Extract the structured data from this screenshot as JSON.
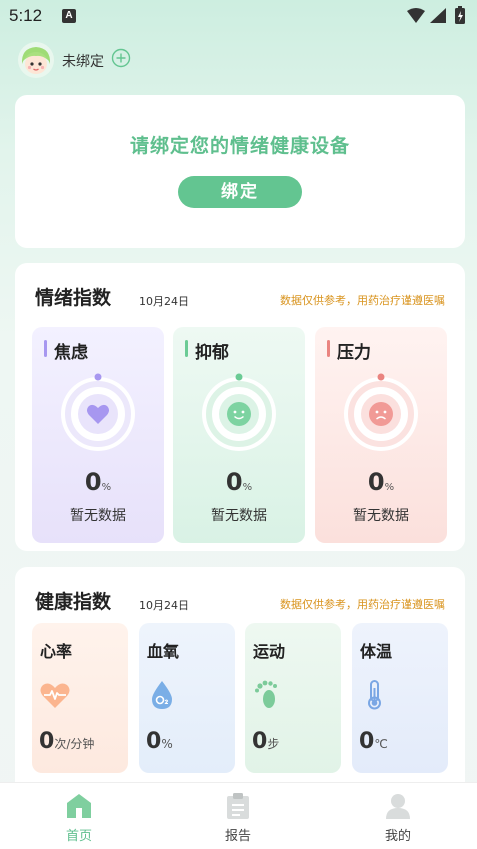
{
  "status_bar": {
    "time": "5:12",
    "notif_letter": "A"
  },
  "header": {
    "bind_status": "未绑定"
  },
  "bind_card": {
    "title": "请绑定您的情绪健康设备",
    "button": "绑定"
  },
  "emotion": {
    "title": "情绪指数",
    "date": "10月24日",
    "note": "数据仅供参考，用药治疗谨遵医嘱",
    "items": [
      {
        "name": "焦虑",
        "value": "0",
        "unit": "%",
        "status": "暂无数据",
        "color": "#a797f0",
        "icon": "heart-icon"
      },
      {
        "name": "抑郁",
        "value": "0",
        "unit": "%",
        "status": "暂无数据",
        "color": "#6bcb95",
        "icon": "smile-icon"
      },
      {
        "name": "压力",
        "value": "0",
        "unit": "%",
        "status": "暂无数据",
        "color": "#ea8480",
        "icon": "frown-icon"
      }
    ]
  },
  "health": {
    "title": "健康指数",
    "date": "10月24日",
    "note": "数据仅供参考，用药治疗谨遵医嘱",
    "items": [
      {
        "name": "心率",
        "value": "0",
        "unit": "次/分钟",
        "icon": "heart-rate-icon",
        "color": "#f9a27a"
      },
      {
        "name": "血氧",
        "value": "0",
        "unit": "%",
        "icon": "oxygen-drop-icon",
        "color": "#6aa3e0"
      },
      {
        "name": "运动",
        "value": "0",
        "unit": "步",
        "icon": "footprint-icon",
        "color": "#6bc48e"
      },
      {
        "name": "体温",
        "value": "0",
        "unit": "℃",
        "icon": "thermometer-icon",
        "color": "#6a9be0"
      }
    ]
  },
  "tabbar": {
    "items": [
      {
        "label": "首页",
        "icon": "home-icon",
        "active": true
      },
      {
        "label": "报告",
        "icon": "report-icon",
        "active": false
      },
      {
        "label": "我的",
        "icon": "profile-icon",
        "active": false
      }
    ]
  },
  "colors": {
    "accent": "#63c591",
    "note": "#d9941f"
  }
}
